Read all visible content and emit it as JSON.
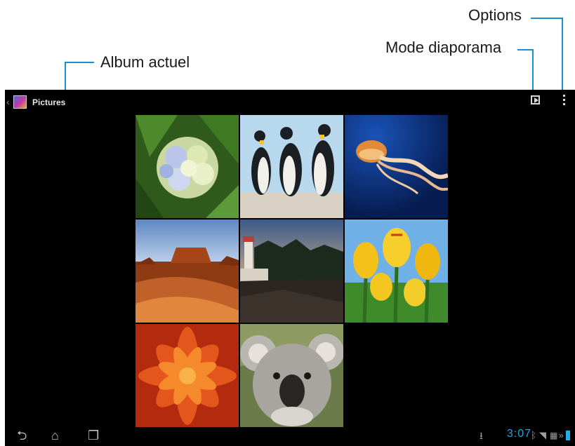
{
  "callouts": {
    "options": "Options",
    "slideshow_mode": "Mode diaporama",
    "current_album": "Album actuel"
  },
  "colors": {
    "callout_accent": "#1b8fd6",
    "screen_bg": "#000000",
    "clock": "#2aa0d8"
  },
  "actionbar": {
    "album_title": "Pictures",
    "album_icon": "gallery-app-icon",
    "slideshow_icon": "slideshow-icon",
    "overflow_icon": "overflow-menu-icon"
  },
  "photos": [
    {
      "subject": "hydrangea"
    },
    {
      "subject": "penguins"
    },
    {
      "subject": "jellyfish"
    },
    {
      "subject": "desert"
    },
    {
      "subject": "lighthouse"
    },
    {
      "subject": "tulips"
    },
    {
      "subject": "chrysanthemum"
    },
    {
      "subject": "koala"
    }
  ],
  "navbar": {
    "back_icon": "back-icon",
    "home_icon": "home-icon",
    "recents_icon": "recent-apps-icon"
  },
  "status_bar": {
    "time": "3:07"
  }
}
